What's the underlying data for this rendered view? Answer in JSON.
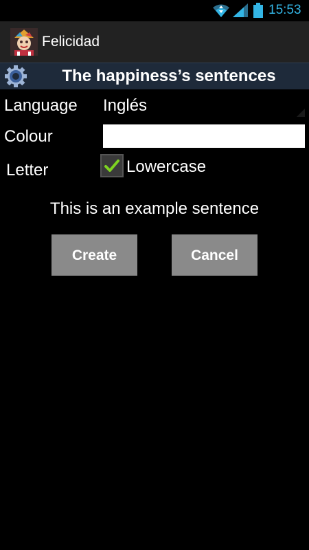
{
  "status_bar": {
    "time": "15:53",
    "accent_color": "#33b5e5",
    "icons": [
      "wifi-icon",
      "signal-icon",
      "battery-icon"
    ]
  },
  "action_bar": {
    "app_title": "Felicidad",
    "app_icon": "app-logo-icon"
  },
  "header": {
    "title": "The happiness’s sentences",
    "icon": "gear-icon"
  },
  "form": {
    "language": {
      "label": "Language",
      "value": "Inglés"
    },
    "colour": {
      "label": "Colour",
      "value": ""
    },
    "letter": {
      "label": "Letter",
      "checkbox_label": "Lowercase",
      "checked": true
    }
  },
  "example_sentence": "This is an example sentence",
  "buttons": {
    "create": "Create",
    "cancel": "Cancel"
  }
}
